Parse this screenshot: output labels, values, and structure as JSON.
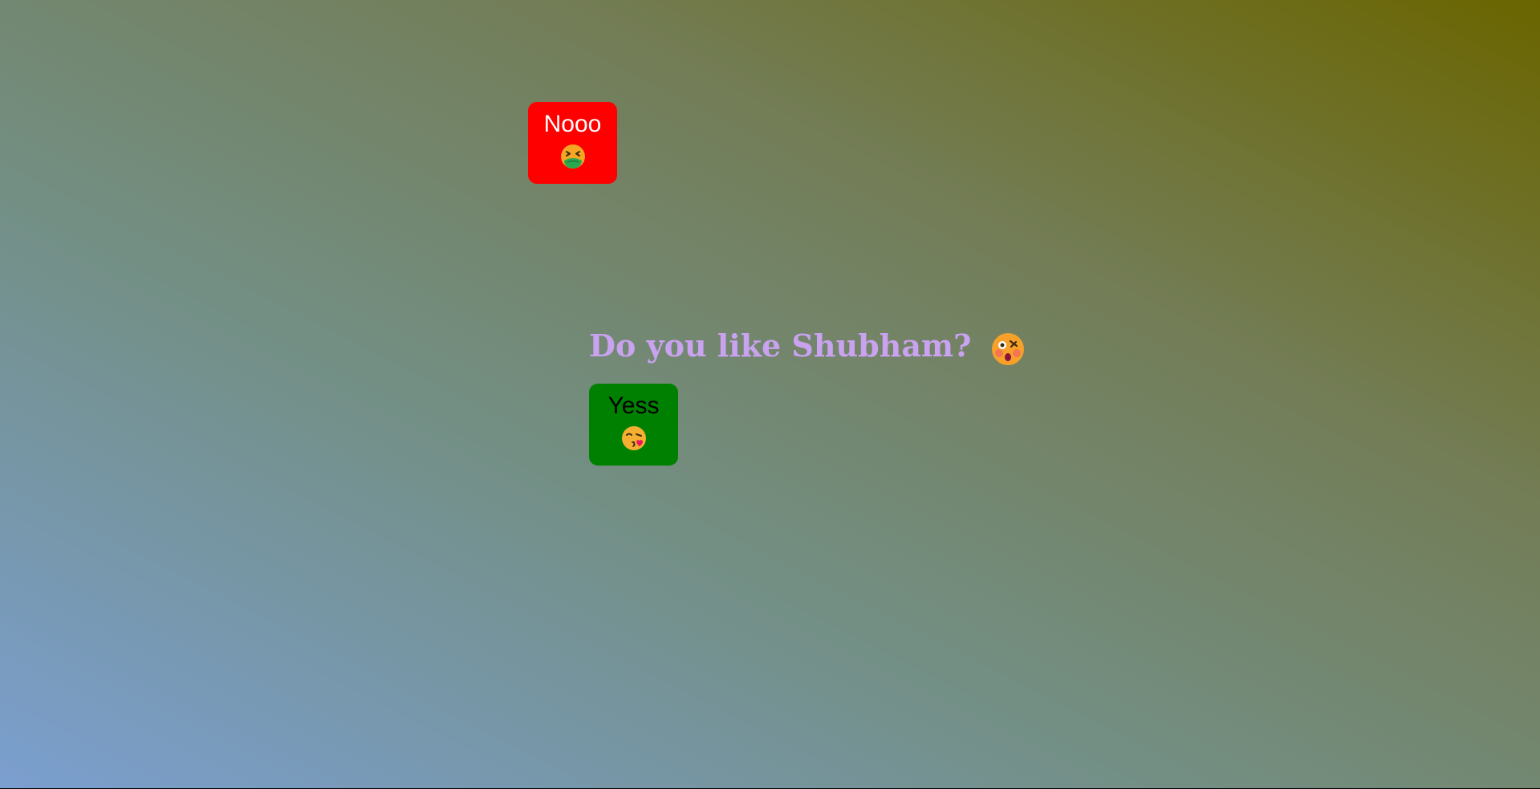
{
  "question": {
    "text": "Do you like Shubham?",
    "emoji_icon": "flushed-face-icon"
  },
  "buttons": {
    "no": {
      "label": "Nooo",
      "emoji_icon": "nauseated-face-icon",
      "color": "#ff0000"
    },
    "yes": {
      "label": "Yess",
      "emoji_icon": "face-blowing-kiss-icon",
      "color": "#008000"
    }
  },
  "colors": {
    "gradient_start": "#7b9fd0",
    "gradient_end": "#6a6500",
    "question_text": "#c9a2f0"
  }
}
